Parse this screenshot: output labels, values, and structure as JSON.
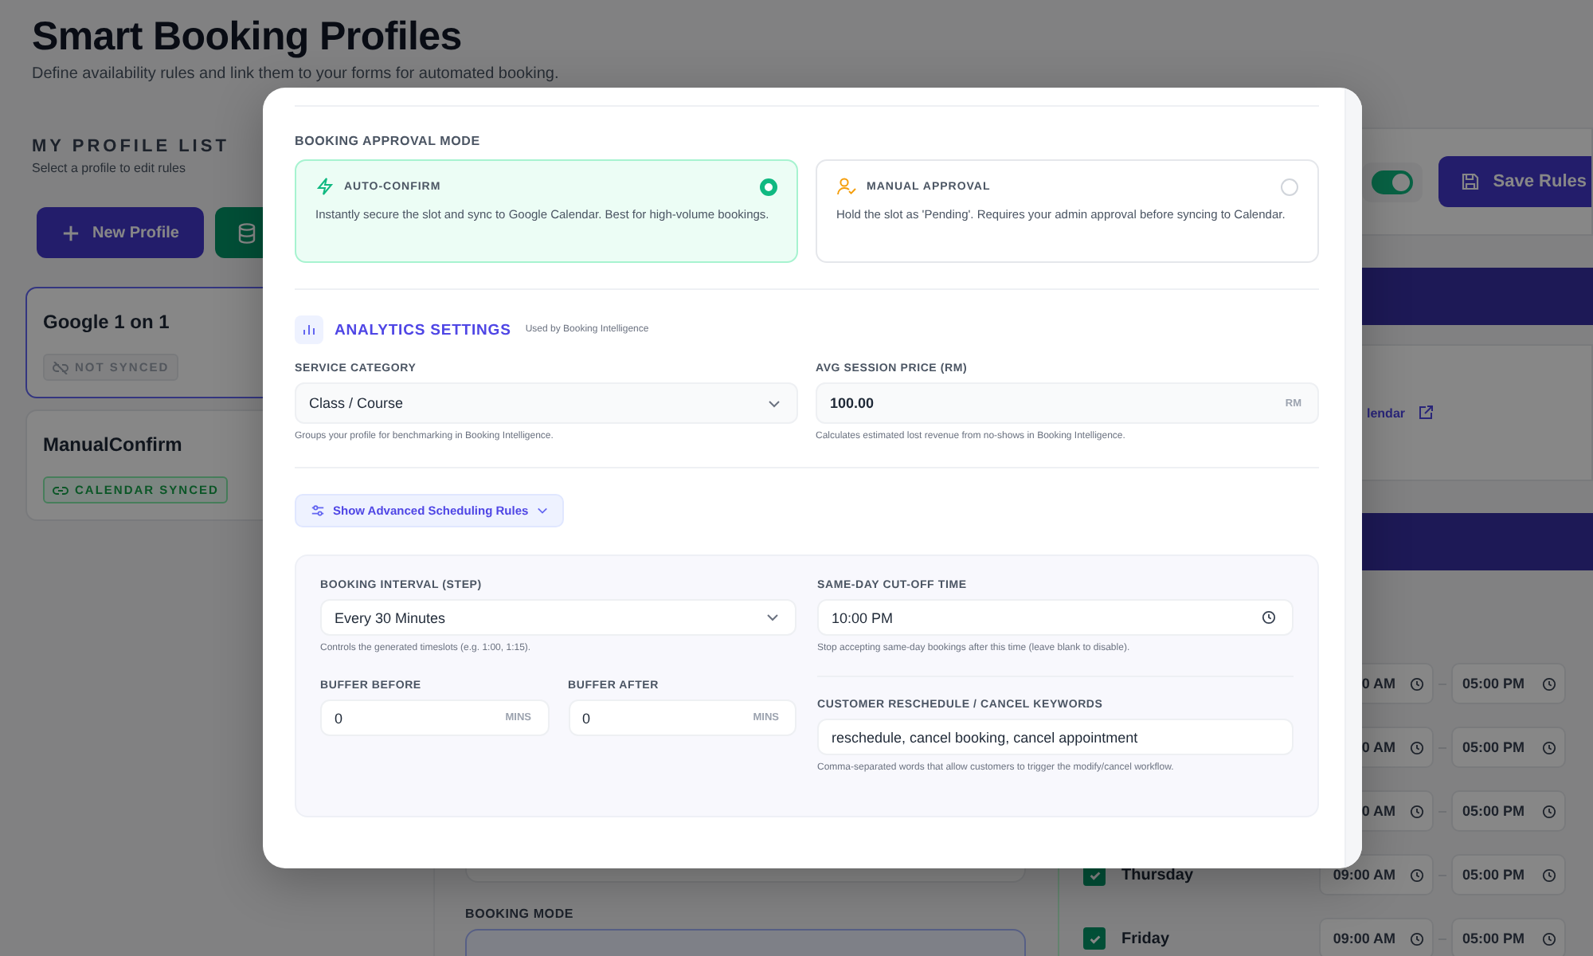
{
  "page": {
    "title": "Smart Booking Profiles",
    "subtitle": "Define availability rules and link them to your forms for automated booking."
  },
  "profile_list": {
    "heading": "MY PROFILE LIST",
    "subheading": "Select a profile to edit rules",
    "new_button": "New Profile",
    "profiles": [
      {
        "name": "Google 1 on 1",
        "status": "NOT SYNCED",
        "synced": false,
        "selected": true
      },
      {
        "name": "ManualConfirm",
        "status": "CALENDAR SYNCED",
        "synced": true,
        "selected": false
      }
    ]
  },
  "header_controls": {
    "toggle_on": true,
    "save_button": "Save Rules"
  },
  "calendar_link": "lendar",
  "schedule": [
    {
      "start": "0 AM",
      "end": "05:00 PM"
    },
    {
      "start": "0 AM",
      "end": "05:00 PM"
    },
    {
      "start": "0 AM",
      "end": "05:00 PM"
    },
    {
      "day": "Thursday",
      "checked": true,
      "start": "09:00 AM",
      "end": "05:00 PM"
    },
    {
      "day": "Friday",
      "checked": true,
      "start": "09:00 AM",
      "end": "05:00 PM"
    }
  ],
  "booking_mode_label": "BOOKING MODE",
  "modal": {
    "approval": {
      "heading": "BOOKING APPROVAL MODE",
      "options": [
        {
          "kind": "auto",
          "title": "AUTO-CONFIRM",
          "description": "Instantly secure the slot and sync to Google Calendar. Best for high-volume bookings.",
          "selected": true
        },
        {
          "kind": "manual",
          "title": "MANUAL APPROVAL",
          "description": "Hold the slot as 'Pending'. Requires your admin approval before syncing to Calendar.",
          "selected": false
        }
      ]
    },
    "analytics": {
      "title": "ANALYTICS SETTINGS",
      "note": "Used by Booking Intelligence",
      "fields": [
        {
          "kind": "select",
          "label": "SERVICE CATEGORY",
          "value": "Class / Course",
          "hint": "Groups your profile for benchmarking in Booking Intelligence."
        },
        {
          "kind": "number",
          "label": "AVG SESSION PRICE (RM)",
          "value": "100.00",
          "unit": "RM",
          "hint": "Calculates estimated lost revenue from no-shows in Booking Intelligence."
        }
      ]
    },
    "advanced_toggle": "Show Advanced Scheduling Rules",
    "advanced": {
      "interval": {
        "label": "BOOKING INTERVAL (STEP)",
        "value": "Every 30 Minutes",
        "hint": "Controls the generated timeslots (e.g. 1:00, 1:15)."
      },
      "buffers": [
        {
          "label": "BUFFER BEFORE",
          "value": "0",
          "unit": "MINS"
        },
        {
          "label": "BUFFER AFTER",
          "value": "0",
          "unit": "MINS"
        }
      ],
      "cutoff": {
        "label": "SAME-DAY CUT-OFF TIME",
        "value": "10:00 PM",
        "hint": "Stop accepting same-day bookings after this time (leave blank to disable)."
      },
      "keywords": {
        "label": "CUSTOMER RESCHEDULE / CANCEL KEYWORDS",
        "value": "reschedule, cancel booking, cancel appointment",
        "hint": "Comma-separated words that allow customers to trigger the modify/cancel workflow."
      }
    }
  }
}
